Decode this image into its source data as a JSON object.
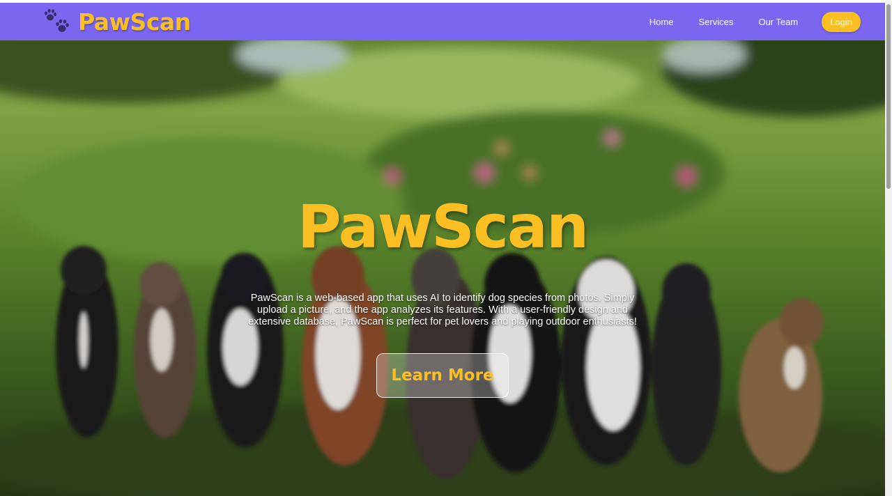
{
  "header": {
    "brand": "PawScan",
    "logo_icon": "paw-prints-icon",
    "nav": [
      {
        "label": "Home"
      },
      {
        "label": "Services"
      },
      {
        "label": "Our Team"
      }
    ],
    "login_label": "Login"
  },
  "hero": {
    "title": "PawScan",
    "description": "PawScan is a web-based app that uses AI to identify dog species from photos. Simply upload a picture, and the app analyzes its features. With a user-friendly design and extensive database, PawScan is perfect for pet lovers and playing outdoor enthusiasts!",
    "cta_label": "Learn More",
    "background": "photo-of-dogs-sitting-in-meadow"
  },
  "colors": {
    "nav_bg": "#7b66ef",
    "accent": "#fbbf24"
  }
}
